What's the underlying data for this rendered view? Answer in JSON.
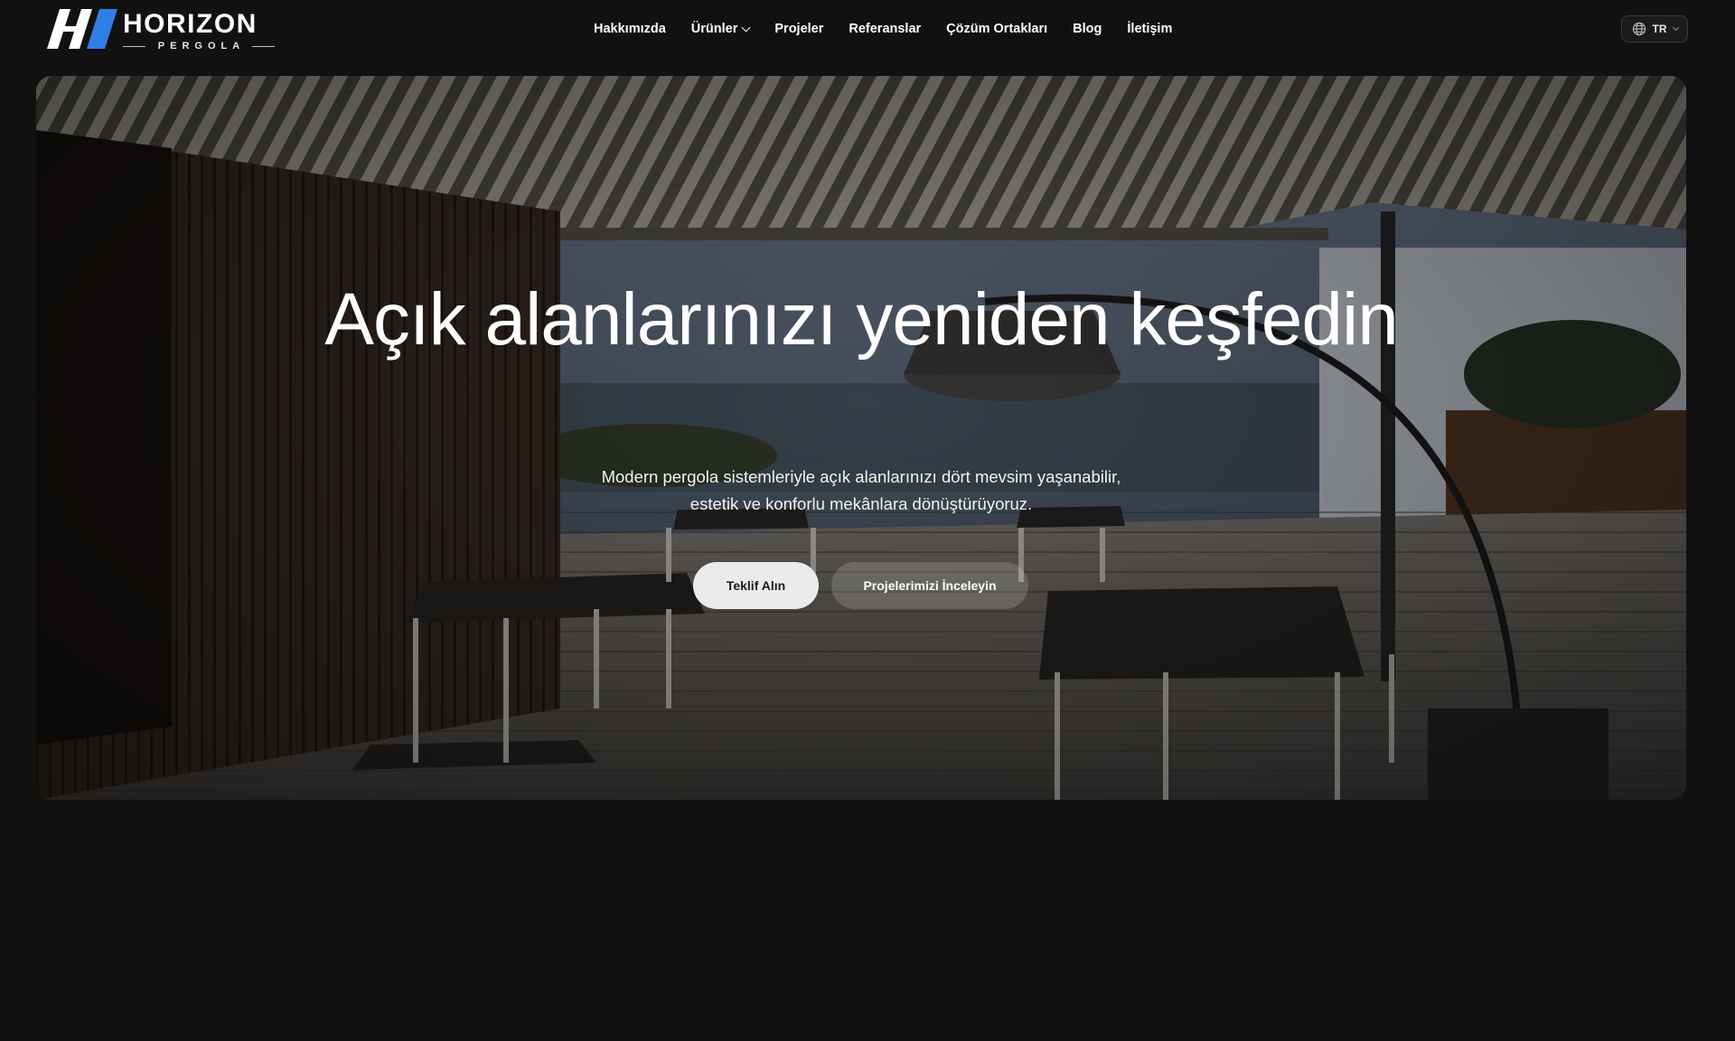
{
  "brand": {
    "name": "HORIZON",
    "tagline": "PERGOLA"
  },
  "nav": {
    "items": [
      {
        "label": "Hakkımızda"
      },
      {
        "label": "Ürünler",
        "has_dropdown": true
      },
      {
        "label": "Projeler"
      },
      {
        "label": "Referanslar"
      },
      {
        "label": "Çözüm Ortakları"
      },
      {
        "label": "Blog"
      },
      {
        "label": "İletişim"
      }
    ]
  },
  "language": {
    "code": "TR",
    "icon": "globe-icon"
  },
  "hero": {
    "title": "Açık alanlarınızı yeniden keşfedin",
    "subtitle_line1": "Modern pergola sistemleriyle açık alanlarınızı dört mevsim yaşanabilir,",
    "subtitle_line2": "estetik ve konforlu mekânlara dönüştürüyoruz.",
    "primary_cta": "Teklif Alın",
    "secondary_cta": "Projelerimizi İnceleyin"
  },
  "colors": {
    "page_background": "#111111",
    "text": "#ffffff",
    "logo_accent": "#2f7ee6",
    "primary_button_bg": "#ebebeb",
    "primary_button_text": "#1a1a1a"
  }
}
